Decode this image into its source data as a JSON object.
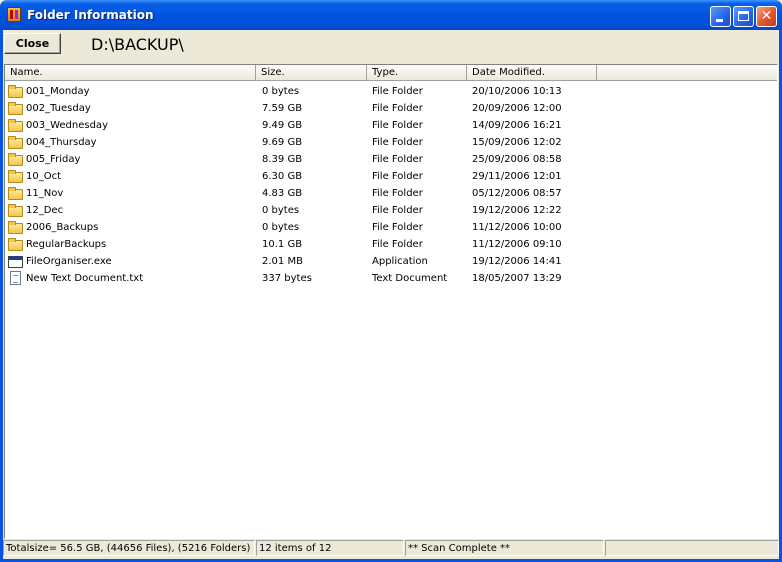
{
  "window": {
    "title": "Folder Information"
  },
  "toolbar": {
    "close_label": "Close",
    "path": "D:\\BACKUP\\"
  },
  "columns": {
    "name": "Name.",
    "size": "Size.",
    "type": "Type.",
    "date": "Date Modified."
  },
  "files": [
    {
      "name": "001_Monday",
      "size": "0 bytes",
      "type": "File Folder",
      "date": "20/10/2006 10:13",
      "icon": "folder-icon"
    },
    {
      "name": "002_Tuesday",
      "size": "7.59 GB",
      "type": "File Folder",
      "date": "20/09/2006 12:00",
      "icon": "folder-icon"
    },
    {
      "name": "003_Wednesday",
      "size": "9.49 GB",
      "type": "File Folder",
      "date": "14/09/2006 16:21",
      "icon": "folder-icon"
    },
    {
      "name": "004_Thursday",
      "size": "9.69 GB",
      "type": "File Folder",
      "date": "15/09/2006 12:02",
      "icon": "folder-icon"
    },
    {
      "name": "005_Friday",
      "size": "8.39 GB",
      "type": "File Folder",
      "date": "25/09/2006 08:58",
      "icon": "folder-icon"
    },
    {
      "name": "10_Oct",
      "size": "6.30 GB",
      "type": "File Folder",
      "date": "29/11/2006 12:01",
      "icon": "folder-icon"
    },
    {
      "name": "11_Nov",
      "size": "4.83 GB",
      "type": "File Folder",
      "date": "05/12/2006 08:57",
      "icon": "folder-icon"
    },
    {
      "name": "12_Dec",
      "size": "0 bytes",
      "type": "File Folder",
      "date": "19/12/2006 12:22",
      "icon": "folder-icon"
    },
    {
      "name": "2006_Backups",
      "size": "0 bytes",
      "type": "File Folder",
      "date": "11/12/2006 10:00",
      "icon": "folder-icon"
    },
    {
      "name": "RegularBackups",
      "size": "10.1 GB",
      "type": "File Folder",
      "date": "11/12/2006 09:10",
      "icon": "folder-icon"
    },
    {
      "name": "FileOrganiser.exe",
      "size": "2.01 MB",
      "type": "Application",
      "date": "19/12/2006 14:41",
      "icon": "application-icon"
    },
    {
      "name": "New Text Document.txt",
      "size": "337 bytes",
      "type": "Text Document",
      "date": "18/05/2007 13:29",
      "icon": "text-document-icon"
    }
  ],
  "status": {
    "totals": "Totalsize= 56.5 GB,  (44656 Files),   (5216 Folders)",
    "count": "12 items of 12",
    "message": "** Scan Complete **",
    "extra": ""
  }
}
